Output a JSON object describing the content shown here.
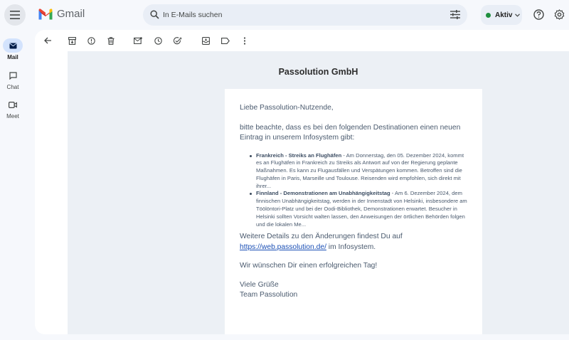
{
  "app": {
    "name": "Gmail"
  },
  "search": {
    "placeholder": "In E-Mails suchen"
  },
  "status": {
    "label": "Aktiv"
  },
  "rail": {
    "items": [
      {
        "label": "Mail"
      },
      {
        "label": "Chat"
      },
      {
        "label": "Meet"
      }
    ]
  },
  "email": {
    "sender_title": "Passolution GmbH",
    "greeting": "Liebe Passolution-Nutzende,",
    "intro": "bitte beachte, dass es bei den folgenden Destinationen einen neuen Eintrag in unserem Infosystem gibt:",
    "items": [
      {
        "title": "Frankreich - Streiks an Flughäfen",
        "text": " - Am Donnerstag, den 05. Dezember 2024, kommt es an Flughäfen in Frankreich zu Streiks als Antwort auf von der Regierung geplante Maßnahmen. Es kann zu Flugausfällen und Verspätungen kommen. Betroffen sind die Flughäfen in Paris, Marseille und Toulouse. Reisenden wird empfohlen, sich direkt mit ihrer..."
      },
      {
        "title": "Finnland - Demonstrationen am Unabhängigkeitstag",
        "text": " - Am 6. Dezember 2024, dem finnischen Unabhängigkeitstag, werden in der Innenstadt von Helsinki, insbesondere am Töölöntori-Platz und bei der Oodi-Bibliothek, Demonstrationen erwartet. Besucher in Helsinki sollten Vorsicht walten lassen, den Anweisungen der örtlichen Behörden folgen und die lokalen Me..."
      }
    ],
    "details_text": "Weitere Details zu den Änderungen findest Du auf",
    "details_link": "https://web.passolution.de/",
    "details_suffix": " im Infosystem.",
    "wish": "Wir wünschen Dir einen erfolgreichen Tag!",
    "regards": "Viele Grüße",
    "team": "Team Passolution"
  },
  "colors": {
    "accent": "#0b57d0",
    "active_rail": "#d3e3fd",
    "status_green": "#1e8e3e",
    "link": "#1a4fb5"
  }
}
